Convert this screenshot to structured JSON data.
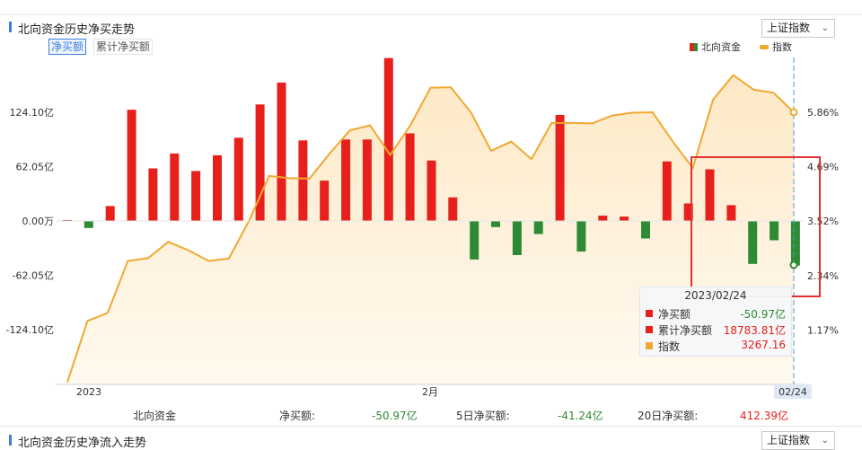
{
  "section1": {
    "title": "北向资金历史净买走势",
    "dropdown_label": "上证指数",
    "tabs": [
      {
        "label": "净买额",
        "active": true
      },
      {
        "label": "累计净买额",
        "active": false
      }
    ],
    "legend": [
      {
        "label": "北向资金",
        "icon": "bar-swatch"
      },
      {
        "label": "指数",
        "icon": "line-swatch"
      }
    ]
  },
  "chart_data": {
    "type": "bar",
    "x_labels": [
      "2023",
      "2月",
      "02/24"
    ],
    "y_left_ticks": [
      "124.10亿",
      "62.05亿",
      "0.00万",
      "-62.05亿",
      "-124.10亿"
    ],
    "y_left_range": [
      -186.15,
      186.15
    ],
    "y_right_ticks": [
      "5.86%",
      "4.69%",
      "3.52%",
      "2.34%",
      "1.17%"
    ],
    "y_right_range": [
      0.0,
      7.03
    ],
    "bar_series": {
      "name": "北向资金",
      "unit": "亿",
      "values": [
        1.0,
        -8.0,
        17.0,
        127.0,
        60.0,
        77.0,
        57.0,
        75.0,
        95.0,
        133.0,
        158.0,
        92.0,
        46.0,
        93.0,
        93.0,
        186.0,
        100.0,
        69.0,
        27.0,
        -44.0,
        -7.0,
        -39.0,
        -15.0,
        121.0,
        -35.0,
        6.0,
        5.0,
        -20.0,
        68.0,
        20.0,
        59.0,
        18.0,
        -49.0,
        -22.0,
        -50.97
      ]
    },
    "line_series": {
      "name": "指数",
      "unit": "%",
      "values": [
        0.05,
        1.37,
        1.54,
        2.66,
        2.72,
        3.07,
        2.89,
        2.66,
        2.71,
        3.52,
        4.49,
        4.44,
        4.43,
        4.97,
        5.47,
        5.58,
        4.94,
        5.58,
        6.39,
        6.4,
        5.86,
        5.03,
        5.23,
        4.85,
        5.63,
        5.63,
        5.62,
        5.79,
        5.85,
        5.86,
        5.23,
        4.66,
        6.13,
        6.66,
        6.35,
        6.28,
        5.86
      ],
      "area_fill": true
    },
    "highlight_index": 34,
    "colors": {
      "bar_positive": "#e8201b",
      "bar_negative": "#2f8a34",
      "line": "#f0a830",
      "area": "#fde7c2",
      "highlight_box": "#e33030",
      "cursor": "#4aa0d8"
    }
  },
  "tooltip": {
    "date": "2023/02/24",
    "rows": [
      {
        "label": "净买额",
        "value": "-50.97亿",
        "swatch": "#e8201b",
        "value_color": "#2f8a34"
      },
      {
        "label": "累计净买额",
        "value": "18783.81亿",
        "swatch": "#e8201b",
        "value_color": "#e8201b"
      },
      {
        "label": "指数",
        "value": "3267.16",
        "swatch": "#f0a830",
        "value_color": "#e8201b"
      }
    ]
  },
  "summary": {
    "name": "北向资金",
    "items": [
      {
        "label": "净买额:",
        "value": "-50.97亿",
        "color": "#2f8a34"
      },
      {
        "label": "5日净买额:",
        "value": "-41.24亿",
        "color": "#2f8a34"
      },
      {
        "label": "20日净买额:",
        "value": "412.39亿",
        "color": "#e8201b"
      }
    ]
  },
  "section2": {
    "title": "北向资金历史净流入走势",
    "dropdown_label": "上证指数"
  }
}
